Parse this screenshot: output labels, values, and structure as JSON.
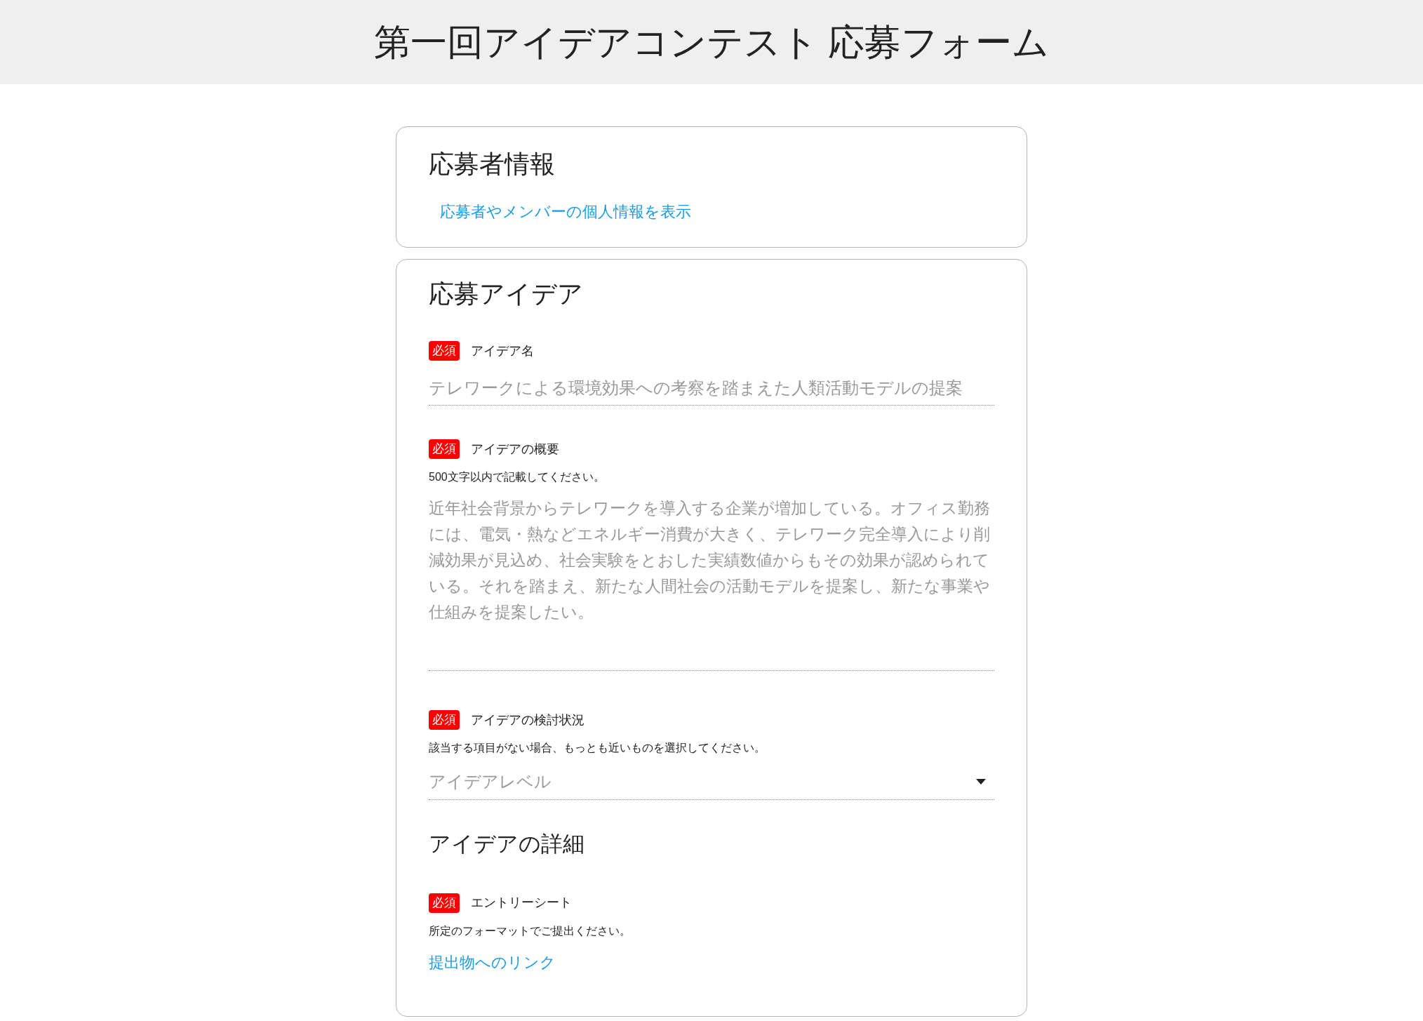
{
  "header": {
    "title": "第一回アイデアコンテスト 応募フォーム"
  },
  "sections": [
    {
      "title": "応募者情報",
      "items": [
        {
          "kind": "link",
          "text": "応募者やメンバーの個人情報を表示"
        }
      ]
    },
    {
      "title": "応募アイデア",
      "items": [
        {
          "kind": "text",
          "badge": "必須",
          "label": "アイデア名",
          "placeholder": "テレワークによる環境効果への考察を踏まえた人類活動モデルの提案"
        },
        {
          "kind": "textarea",
          "badge": "必須",
          "label": "アイデアの概要",
          "note": "500文字以内で記載してください。",
          "placeholder": "近年社会背景からテレワークを導入する企業が増加している。オフィス勤務には、電気・熱などエネルギー消費が大きく、テレワーク完全導入により削減効果が見込め、社会実験をとおした実績数値からもその効果が認められている。それを踏まえ、新たな人間社会の活動モデルを提案し、新たな事業や仕組みを提案したい。"
        },
        {
          "kind": "select",
          "badge": "必須",
          "label": "アイデアの検討状況",
          "note": "該当する項目がない場合、もっとも近いものを選択してください。",
          "placeholder": "アイデアレベル"
        },
        {
          "kind": "heading",
          "text": "アイデアの詳細"
        },
        {
          "kind": "file",
          "badge": "必須",
          "label": "エントリーシート",
          "note": "所定のフォーマットでご提出ください。",
          "link": "提出物へのリンク"
        }
      ]
    }
  ]
}
